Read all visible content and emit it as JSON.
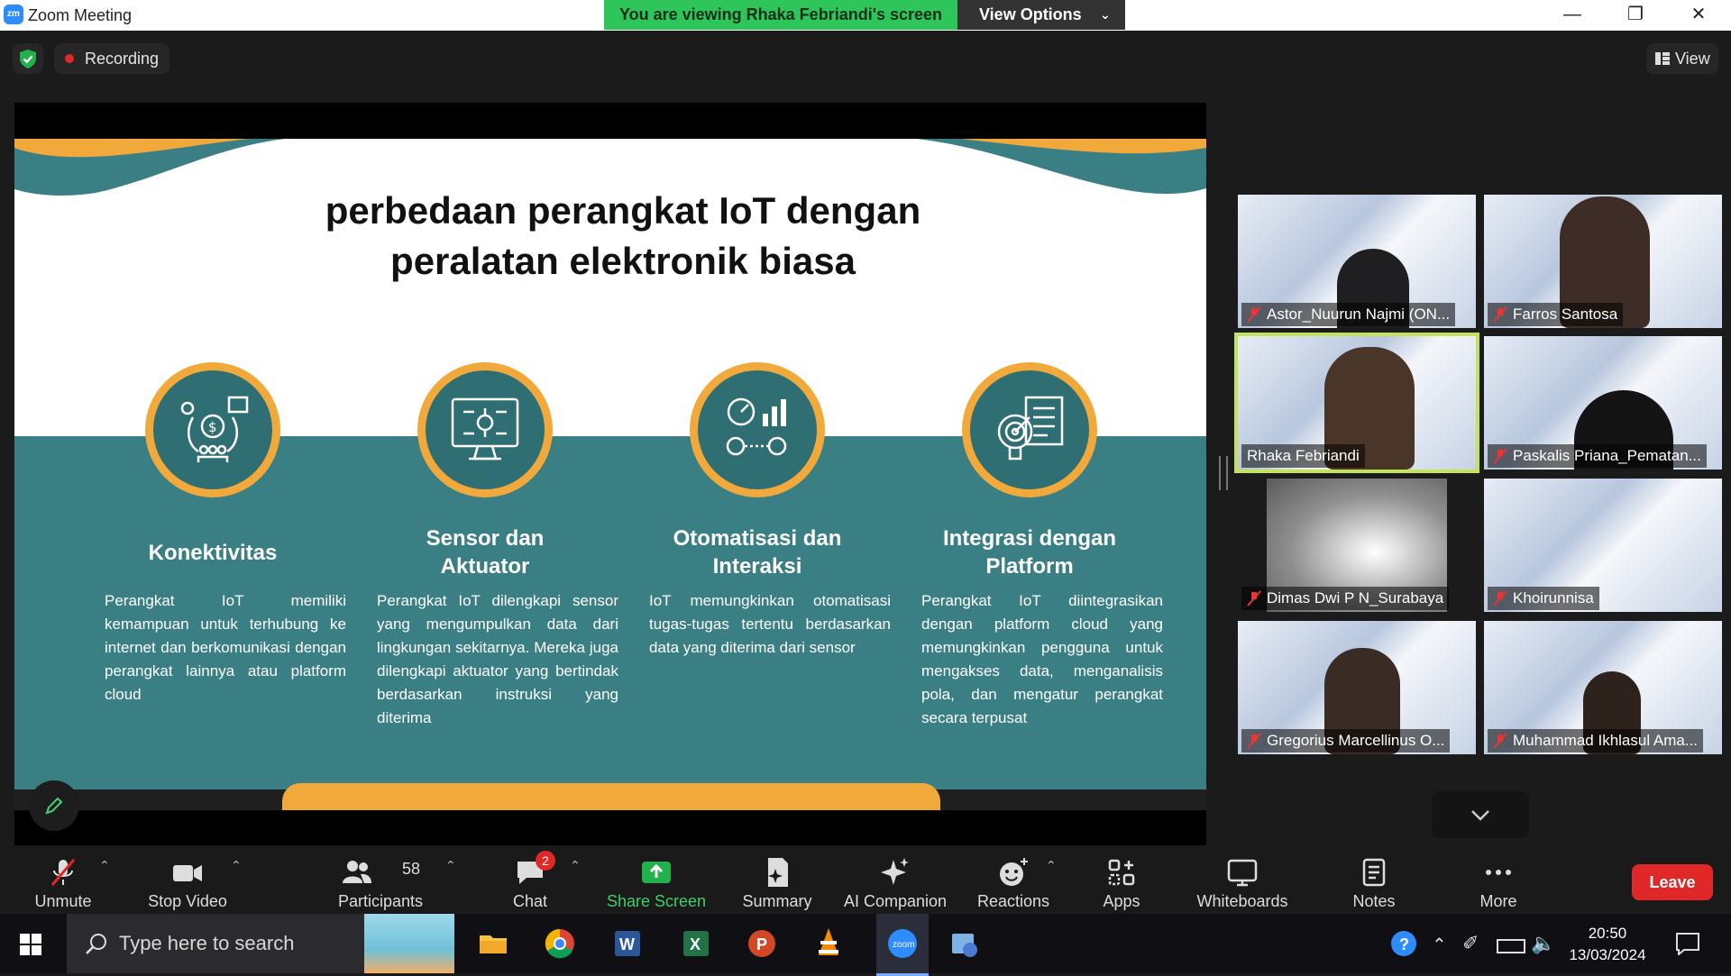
{
  "window": {
    "logo_text": "zm",
    "title": "Zoom Meeting",
    "viewing_banner": "You are viewing Rhaka Febriandi's screen",
    "view_options": "View Options"
  },
  "top_bar": {
    "recording_label": "Recording",
    "view_label": "View"
  },
  "slide": {
    "title_line1": "perbedaan perangkat IoT dengan",
    "title_line2": "peralatan elektronik biasa",
    "features": [
      {
        "title": "Konektivitas",
        "text": "Perangkat IoT memiliki kemampuan untuk terhubung ke internet dan berkomunikasi dengan perangkat lainnya atau platform cloud"
      },
      {
        "title_line1": "Sensor dan",
        "title_line2": "Aktuator",
        "text": "Perangkat IoT dilengkapi sensor yang mengumpulkan data dari lingkungan sekitarnya. Mereka juga dilengkapi aktuator yang bertindak berdasarkan instruksi yang diterima"
      },
      {
        "title_line1": "Otomatisasi dan",
        "title_line2": "Interaksi",
        "text": "IoT memungkinkan otomatisasi tugas-tugas tertentu berdasarkan data yang diterima dari sensor"
      },
      {
        "title_line1": "Integrasi dengan",
        "title_line2": "Platform",
        "text": "Perangkat IoT diintegrasikan dengan platform cloud yang memungkinkan pengguna untuk mengakses data, menganalisis pola, dan mengatur perangkat secara terpusat"
      }
    ],
    "colors": {
      "teal": "#3a7f84",
      "orange": "#f2a93b"
    }
  },
  "participants_gallery": [
    {
      "name": "Astor_Nuurun Najmi (ON...",
      "muted": true
    },
    {
      "name": "Farros Santosa",
      "muted": true
    },
    {
      "name": "Rhaka Febriandi",
      "muted": false,
      "active_speaker": true
    },
    {
      "name": "Paskalis Priana_Pematan...",
      "muted": true
    },
    {
      "name": "Dimas Dwi P N_Surabaya",
      "muted": true
    },
    {
      "name": "Khoirunnisa",
      "muted": true
    },
    {
      "name": "Gregorius Marcellinus O...",
      "muted": true
    },
    {
      "name": "Muhammad Ikhlasul Ama...",
      "muted": true
    }
  ],
  "toolbar": {
    "unmute": "Unmute",
    "stop_video": "Stop Video",
    "participants": "Participants",
    "participants_count": "58",
    "chat": "Chat",
    "chat_badge": "2",
    "share_screen": "Share Screen",
    "summary": "Summary",
    "ai_companion": "AI Companion",
    "reactions": "Reactions",
    "apps": "Apps",
    "whiteboards": "Whiteboards",
    "notes": "Notes",
    "more": "More",
    "leave": "Leave"
  },
  "taskbar": {
    "search_placeholder": "Type here to search",
    "time": "20:50",
    "date": "13/03/2024"
  }
}
